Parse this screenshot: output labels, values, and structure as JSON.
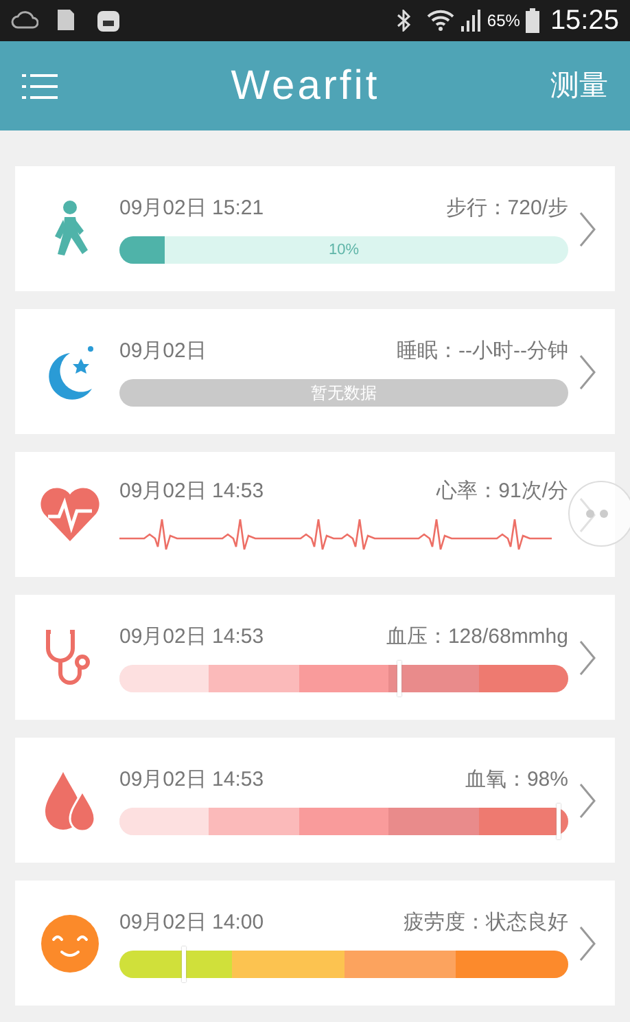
{
  "status_bar": {
    "battery": "65%",
    "time": "15:25"
  },
  "header": {
    "title": "Wearfit",
    "action": "测量"
  },
  "cards": [
    {
      "kind": "progress",
      "date": "09月02日 15:21",
      "reading": "步行：720/步",
      "level": 0.1,
      "bar_label": "10%"
    },
    {
      "kind": "empty",
      "date": "09月02日",
      "reading": "睡眠：--小时--分钟",
      "bar_label": "暂无数据"
    },
    {
      "kind": "wave",
      "date": "09月02日 14:53",
      "reading": "心率：91次/分"
    },
    {
      "kind": "segments",
      "date": "09月02日 14:53",
      "reading": "血压：128/68mmhg",
      "level": 0.625,
      "segments": [
        {
          "color": "#fde0e0"
        },
        {
          "color": "#fbbaba"
        },
        {
          "color": "#f99b9b"
        },
        {
          "color": "#e98b8b"
        },
        {
          "color": "#ee7a70"
        }
      ]
    },
    {
      "kind": "segments",
      "date": "09月02日 14:53",
      "reading": "血氧：98%",
      "level": 0.98,
      "segments": [
        {
          "color": "#fde0e0"
        },
        {
          "color": "#fbbaba"
        },
        {
          "color": "#f99b9b"
        },
        {
          "color": "#e98b8b"
        },
        {
          "color": "#ee7a70"
        }
      ]
    },
    {
      "kind": "segments",
      "date": "09月02日 14:00",
      "reading": "疲劳度：状态良好",
      "level": 0.145,
      "segments": [
        {
          "color": "#d0e03a"
        },
        {
          "color": "#fcc350"
        },
        {
          "color": "#fca35e"
        },
        {
          "color": "#fc8a2c"
        }
      ]
    }
  ]
}
